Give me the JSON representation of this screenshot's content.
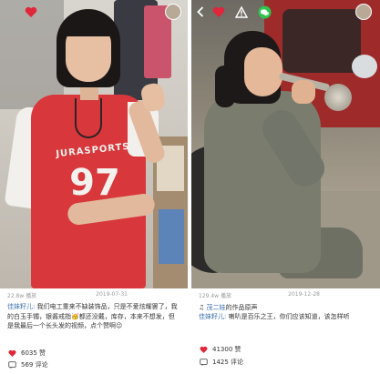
{
  "posts": [
    {
      "header": {
        "like_icon": "heart-icon",
        "avatar": "avatar"
      },
      "meta": {
        "plays": "22.8w 播放",
        "date": "2019-07-31"
      },
      "caption": {
        "user": "佳妹籽儿:",
        "text": "我们电工重来不缺装饰品，只是不爱炫耀罢了，我的白玉手镯，银酱戒指🥳都还没戴，库存，本来不想发，但是我最后一个长头发的视频，点个赞啊😉"
      },
      "stats": [
        {
          "icon": "heart-icon",
          "value": "6035 赞"
        },
        {
          "icon": "comment-icon",
          "value": "569 评论"
        }
      ],
      "photo": {
        "jersey_text": "JURASPORTS",
        "jersey_number": "97"
      }
    },
    {
      "header": {
        "back_icon": "back-arrow-icon",
        "like_icon": "heart-icon",
        "report_icon": "warning-icon",
        "share_icon": "wechat-icon",
        "avatar": "avatar"
      },
      "meta": {
        "plays": "129.4w 播放",
        "date": "2019-12-28"
      },
      "sound": {
        "prefix": "茂二娃",
        "suffix": "的作品原声"
      },
      "caption": {
        "user": "佳妹籽儿:",
        "text": "喇叭是百乐之王，你们应该知道，该怎样听"
      },
      "stats": [
        {
          "icon": "heart-icon",
          "value": "41300 赞"
        },
        {
          "icon": "comment-icon",
          "value": "1425 评论"
        }
      ]
    }
  ],
  "colors": {
    "link": "#3a6fb0",
    "like": "#e0263a",
    "meta": "#9a9a9a",
    "text": "#333333"
  }
}
